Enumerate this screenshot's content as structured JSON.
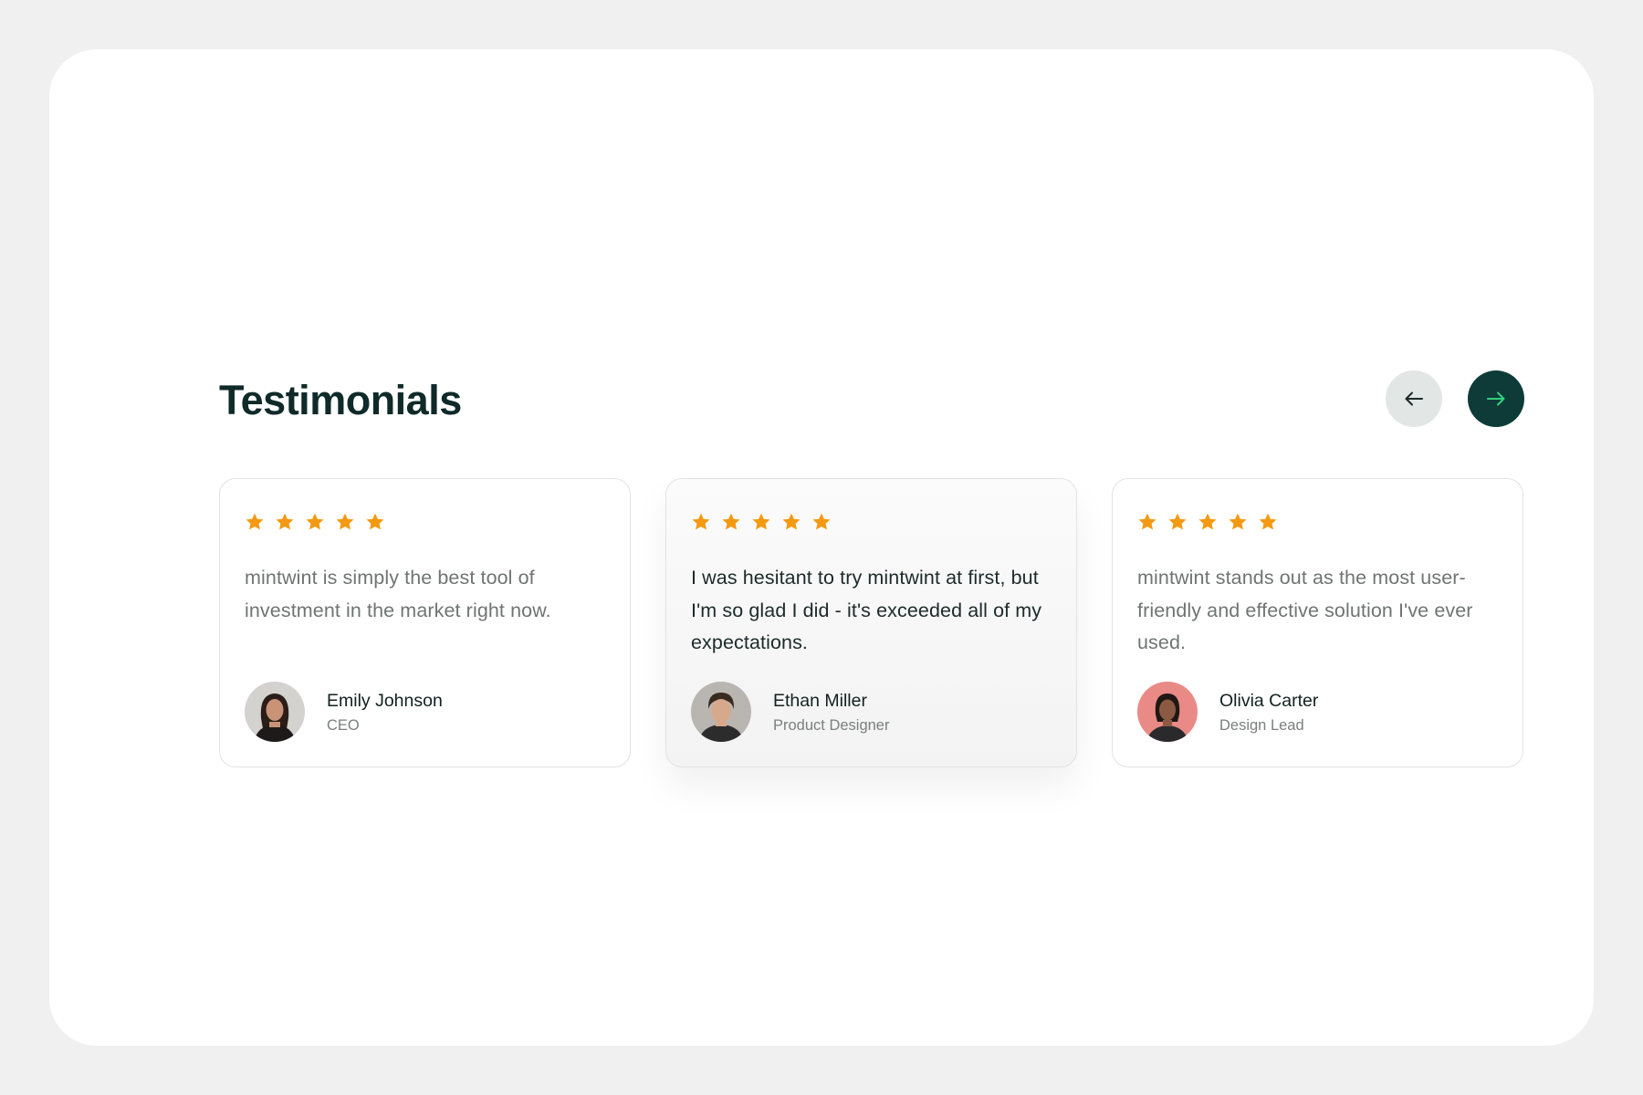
{
  "section": {
    "title": "Testimonials",
    "nav": {
      "prev_icon": "arrow-left-icon",
      "next_icon": "arrow-right-icon"
    }
  },
  "colors": {
    "title": "#0f2a29",
    "star": "#f39a12",
    "next_button_bg": "#0e3b38",
    "next_arrow": "#32d07a",
    "prev_button_bg": "#e2e6e5",
    "page_bg": "#f0f0f0"
  },
  "testimonials": [
    {
      "rating": 5,
      "quote": "mintwint is simply the best tool of investment in the market right now.",
      "name": "Emily Johnson",
      "role": "CEO",
      "active": false
    },
    {
      "rating": 5,
      "quote": "I was hesitant to try mintwint at first, but I'm so glad I did - it's exceeded all of my expectations.",
      "name": "Ethan Miller",
      "role": "Product Designer",
      "active": true
    },
    {
      "rating": 5,
      "quote": "mintwint stands out as the most user-friendly and effective solution I've ever used.",
      "name": "Olivia Carter",
      "role": "Design Lead",
      "active": false
    }
  ]
}
